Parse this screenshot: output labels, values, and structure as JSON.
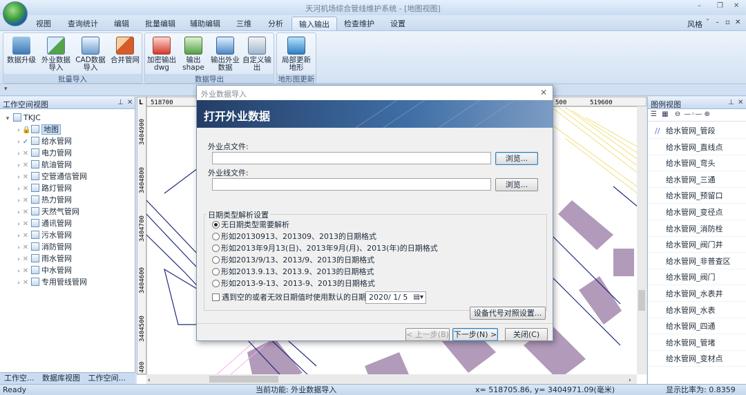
{
  "window": {
    "title": "天河机场综合管线维护系统 - [地图视图]"
  },
  "menu": {
    "items": [
      "视图",
      "查询统计",
      "编辑",
      "批量编辑",
      "辅助编辑",
      "三维",
      "分析",
      "输入输出",
      "检查维护",
      "设置"
    ],
    "active": "输入输出",
    "style_label": "风格"
  },
  "ribbon": {
    "groups": [
      {
        "title": "批量导入",
        "buttons": [
          "数据升级",
          "外业数据导入",
          "CAD数据导入",
          "合并管网"
        ]
      },
      {
        "title": "数据导出",
        "buttons": [
          "加密输出dwg",
          "输出shape",
          "输出外业数据",
          "自定义输出"
        ]
      },
      {
        "title": "地形图更新",
        "buttons": [
          "局部更新地形"
        ]
      }
    ],
    "icons": [
      "database-icon",
      "import-icon",
      "cad-icon",
      "merge-icon",
      "dwg-icon",
      "shape-icon",
      "export-icon",
      "custom-export-icon",
      "terrain-icon"
    ]
  },
  "left_panel": {
    "title": "工作空间视图",
    "root": "TKJC",
    "map_node": "地图",
    "layers": [
      {
        "name": "给水管网",
        "checked": true
      },
      {
        "name": "电力管网",
        "checked": false
      },
      {
        "name": "航油管网",
        "checked": false
      },
      {
        "name": "空管通信管网",
        "checked": false
      },
      {
        "name": "路灯管网",
        "checked": false
      },
      {
        "name": "热力管网",
        "checked": false
      },
      {
        "name": "天然气管网",
        "checked": false
      },
      {
        "name": "通讯管网",
        "checked": false
      },
      {
        "name": "污水管网",
        "checked": false
      },
      {
        "name": "消防管网",
        "checked": false
      },
      {
        "name": "雨水管网",
        "checked": false
      },
      {
        "name": "中水管网",
        "checked": false
      },
      {
        "name": "专用管线管网",
        "checked": false
      }
    ],
    "tabs": [
      "工作空...",
      "数据库视图",
      "工作空间..."
    ]
  },
  "map": {
    "ruler_top": [
      "518700",
      "500",
      "519600"
    ],
    "ruler_left": [
      "3404900",
      "3404800",
      "3404700",
      "3404600",
      "3404500",
      "400"
    ],
    "colors": {
      "building": "#b19aba",
      "pipe": "#1f2a7a",
      "yellow_line": "#f0e07a",
      "pink_line": "#f3b2f3"
    }
  },
  "right_panel": {
    "title": "图例视图",
    "items": [
      "给水管网_管段",
      "给水管网_直线点",
      "给水管网_弯头",
      "给水管网_三通",
      "给水管网_预留口",
      "给水管网_变径点",
      "给水管网_消防栓",
      "给水管网_阀门井",
      "给水管网_非普查区",
      "给水管网_阀门",
      "给水管网_水表井",
      "给水管网_水表",
      "给水管网_四通",
      "给水管网_管堵",
      "给水管网_变材点"
    ]
  },
  "dialog": {
    "title": "外业数据导入",
    "banner": "打开外业数据",
    "point_file_label": "外业点文件:",
    "line_file_label": "外业线文件:",
    "browse_label": "浏览...",
    "date_group_title": "日期类型解析设置",
    "date_options": [
      "无日期类型需要解析",
      "形如20130913、201309、2013的日期格式",
      "形如2013年9月13(日)、2013年9月(月)、2013(年)的日期格式",
      "形如2013/9/13、2013/9、2013的日期格式",
      "形如2013.9.13、2013.9、2013的日期格式",
      "形如2013-9-13、2013-9、2013的日期格式"
    ],
    "selected_option": 0,
    "default_date_label": "遇到空的或者无效日期值时使用默认的日期:",
    "default_date_value": "2020/ 1/ 5",
    "device_code_button": "设备代号对照设置...",
    "prev_button": "< 上一步(B)",
    "next_button": "下一步(N) >",
    "close_button": "关闭(C)"
  },
  "status": {
    "ready": "Ready",
    "current_function": "当前功能: 外业数据导入",
    "coords": "x= 518705.86, y= 3404971.09(毫米)",
    "scale": "显示比率为: 0.8359"
  }
}
